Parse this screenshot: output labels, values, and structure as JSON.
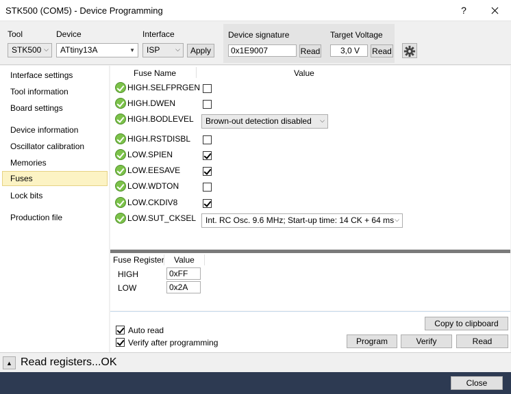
{
  "window": {
    "title": "STK500 (COM5) - Device Programming",
    "help_label": "?"
  },
  "toolbar": {
    "tool_label": "Tool",
    "tool_value": "STK500",
    "device_label": "Device",
    "device_value": "ATtiny13A",
    "interface_label": "Interface",
    "interface_value": "ISP",
    "apply_label": "Apply",
    "signature_label": "Device signature",
    "signature_value": "0x1E9007",
    "signature_read_label": "Read",
    "voltage_label": "Target Voltage",
    "voltage_value": "3,0 V",
    "voltage_read_label": "Read"
  },
  "sidebar": {
    "items": [
      {
        "label": "Interface settings"
      },
      {
        "label": "Tool information"
      },
      {
        "label": "Board settings"
      },
      {
        "label": "Device information"
      },
      {
        "label": "Oscillator calibration"
      },
      {
        "label": "Memories"
      },
      {
        "label": "Fuses"
      },
      {
        "label": "Lock bits"
      },
      {
        "label": "Production file"
      }
    ],
    "active": "Fuses"
  },
  "fuses": {
    "col_name": "Fuse Name",
    "col_value": "Value",
    "rows": [
      {
        "name": "HIGH.SELFPRGEN",
        "checked": false
      },
      {
        "name": "HIGH.DWEN",
        "checked": false
      },
      {
        "name": "HIGH.BODLEVEL",
        "value": "Brown-out detection disabled"
      },
      {
        "name": "HIGH.RSTDISBL",
        "checked": false
      },
      {
        "name": "LOW.SPIEN",
        "checked": true
      },
      {
        "name": "LOW.EESAVE",
        "checked": true
      },
      {
        "name": "LOW.WDTON",
        "checked": false
      },
      {
        "name": "LOW.CKDIV8",
        "checked": true
      },
      {
        "name": "LOW.SUT_CKSEL",
        "value": "Int. RC Osc. 9.6 MHz; Start-up time: 14 CK + 64 ms"
      }
    ]
  },
  "registers": {
    "col_register": "Fuse Register",
    "col_value": "Value",
    "rows": [
      {
        "name": "HIGH",
        "value": "0xFF"
      },
      {
        "name": "LOW",
        "value": "0x2A"
      }
    ]
  },
  "options": {
    "auto_read_label": "Auto read",
    "auto_read_checked": true,
    "verify_label": "Verify after programming",
    "verify_checked": true
  },
  "actions": {
    "copy_label": "Copy to clipboard",
    "program_label": "Program",
    "verify_label": "Verify",
    "read_label": "Read"
  },
  "status": {
    "text": "Read registers...OK",
    "toggle_glyph": "▲"
  },
  "footer": {
    "close_label": "Close"
  }
}
